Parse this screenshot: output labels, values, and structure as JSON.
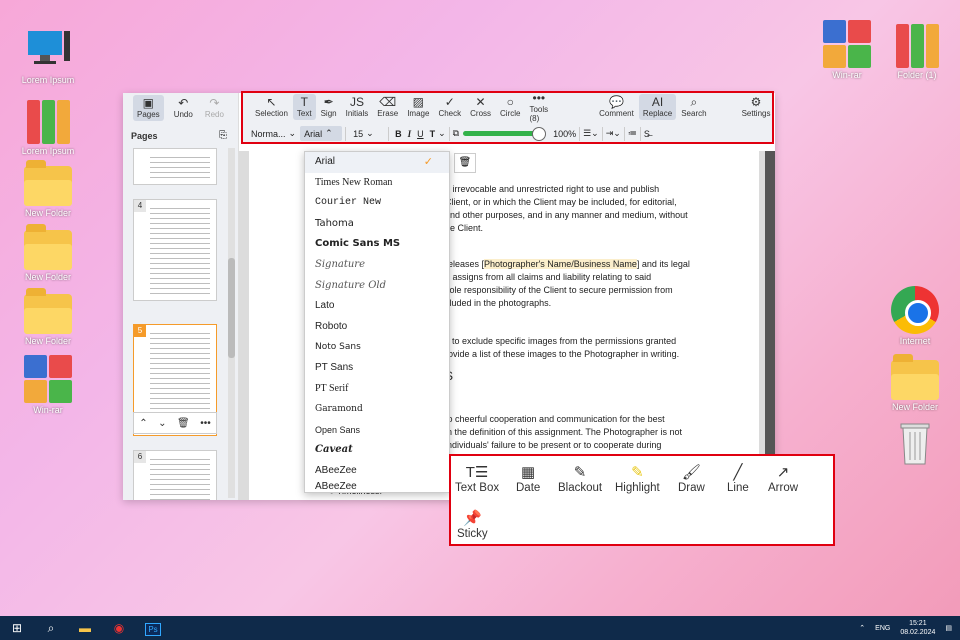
{
  "desktop": {
    "left_icons": [
      {
        "label": "Lorem Ipsum"
      },
      {
        "label": "Lorem Ipsum"
      },
      {
        "label": "New Folder"
      },
      {
        "label": "New Folder"
      },
      {
        "label": "New Folder"
      },
      {
        "label": "Win-rar"
      }
    ],
    "right_icons": [
      {
        "label": "Win-rar"
      },
      {
        "label": "Folder (1)"
      },
      {
        "label": "Internet"
      },
      {
        "label": "New Folder"
      }
    ]
  },
  "sidebar": {
    "pages_btn": "Pages",
    "undo_btn": "Undo",
    "redo_btn": "Redo",
    "pages_label": "Pages",
    "thumbs": [
      "4",
      "5",
      "6"
    ]
  },
  "toolbar": {
    "tools": [
      "Selection",
      "Text",
      "Sign",
      "Initials",
      "Erase",
      "Image",
      "Check",
      "Cross",
      "Circle",
      "Tools (8)",
      "Comment",
      "Replace",
      "Search",
      "Settings"
    ],
    "style_value": "Norma...",
    "font_value": "Arial",
    "size_value": "15",
    "bold": "B",
    "italic": "I",
    "underline": "U",
    "text_color": "T",
    "opacity": "100%",
    "accent": "#33b24a"
  },
  "font_menu": {
    "items": [
      "Arial",
      "Times New Roman",
      "Courier New",
      "Tahoma",
      "Comic Sans MS",
      "Signature",
      "Signature Old",
      "Lato",
      "Roboto",
      "Noto Sans",
      "PT Sans",
      "PT Serif",
      "Garamond",
      "Open Sans",
      "Caveat",
      "ABeeZee",
      "ABeeZee"
    ],
    "selected": "Arial"
  },
  "document": {
    "lines": [
      "e irrevocable and unrestricted right to use and publish",
      "Client, or in which the Client may be included, for editorial,",
      "and other purposes, and in any manner and medium, without",
      "he Client.",
      "releases [",
      "Photographer's Name/Business Name",
      "] and its legal",
      "d assigns from all claims and liability relating to said",
      "sole responsibility of the Client to secure permission from",
      "cluded in the photographs.",
      "s to exclude specific images from the permissions granted",
      "rovide a list of these images to the Photographer in writing.",
      "S",
      "to cheerful cooperation and communication for the best",
      "in the definition of this assignment. The Photographer is not",
      "individuals' failure to be present or to cooperate during",
      "Timeliness:"
    ]
  },
  "annot_tools": [
    "Text Box",
    "Date",
    "Blackout",
    "Highlight",
    "Draw",
    "Line",
    "Arrow",
    "Sticky"
  ],
  "taskbar": {
    "lang": "ENG",
    "time": "15:21",
    "date": "08.02.2024"
  }
}
